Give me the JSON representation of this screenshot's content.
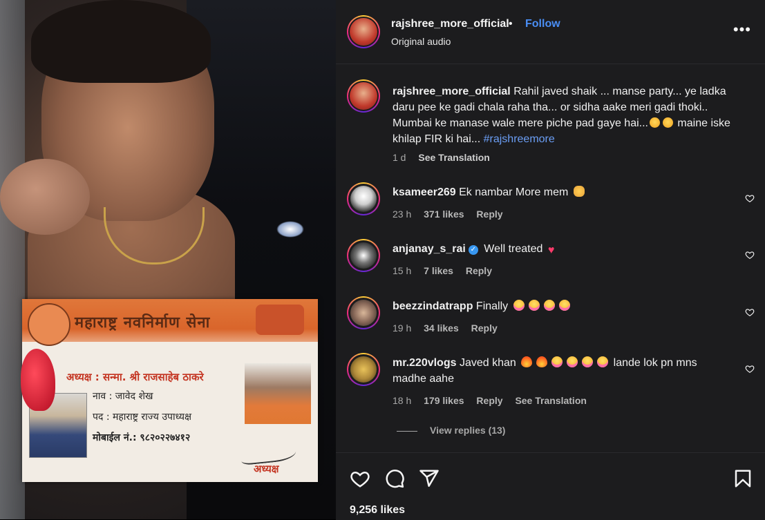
{
  "post": {
    "username": "rajshree_more_official",
    "follow_label": "Follow",
    "dot": "•",
    "audio": "Original audio",
    "more_label": "•••"
  },
  "media": {
    "card_title": "महाराष्ट्र नवनिर्माण सेना",
    "card_line1": "अध्यक्ष : सन्मा. श्री राजसाहेब ठाकरे",
    "card_line2": "नाव : जावेद शेख",
    "card_line3": "पद : महाराष्ट्र राज्य उपाध्यक्ष",
    "card_line4": "मोबाईल नं.: ९८२०२२७४१२",
    "card_sign_label": "अध्यक्ष"
  },
  "caption": {
    "username": "rajshree_more_official",
    "text_part1": " Rahil javed shaik ... manse party... ye ladka daru pee ke gadi chala raha tha... or sidha aake meri gadi thoki.. Mumbai ke manase wale mere piche pad gaye hai...",
    "text_part2": " maine iske khilap FIR ki hai... ",
    "hashtag": "#rajshreemore",
    "time": "1 d",
    "see_translation": "See Translation"
  },
  "comments": [
    {
      "username": "ksameer269",
      "text": " Ek nambar More mem ",
      "time": "23 h",
      "likes": "371 likes",
      "reply": "Reply",
      "avatar_color": "#cfcfcf"
    },
    {
      "username": "anjanay_s_rai",
      "verified_mark": "✓",
      "text": " Well treated ",
      "time": "15 h",
      "likes": "7 likes",
      "reply": "Reply",
      "avatar_color": "#3a3a3a"
    },
    {
      "username": "beezzindatrapp",
      "text": " Finally ",
      "time": "19 h",
      "likes": "34 likes",
      "reply": "Reply",
      "avatar_color": "#8a6a5a"
    },
    {
      "username": "mr.220vlogs",
      "text_part1": " Javed khan ",
      "text_part2": " lande lok pn mns madhe aahe",
      "time": "18 h",
      "likes": "179 likes",
      "reply": "Reply",
      "see_translation": "See Translation",
      "avatar_color": "#b08a3a"
    }
  ],
  "view_replies": "View replies (13)",
  "likes_count": "9,256 likes",
  "icons": {
    "like": "heart-icon",
    "comment": "comment-icon",
    "share": "share-icon",
    "save": "bookmark-icon",
    "more": "more-icon"
  },
  "colors": {
    "panel_bg": "#1c1c1e",
    "follow_blue": "#4a8ef5",
    "hashtag_blue": "#6b9ef5",
    "verified_blue": "#3897f0"
  }
}
